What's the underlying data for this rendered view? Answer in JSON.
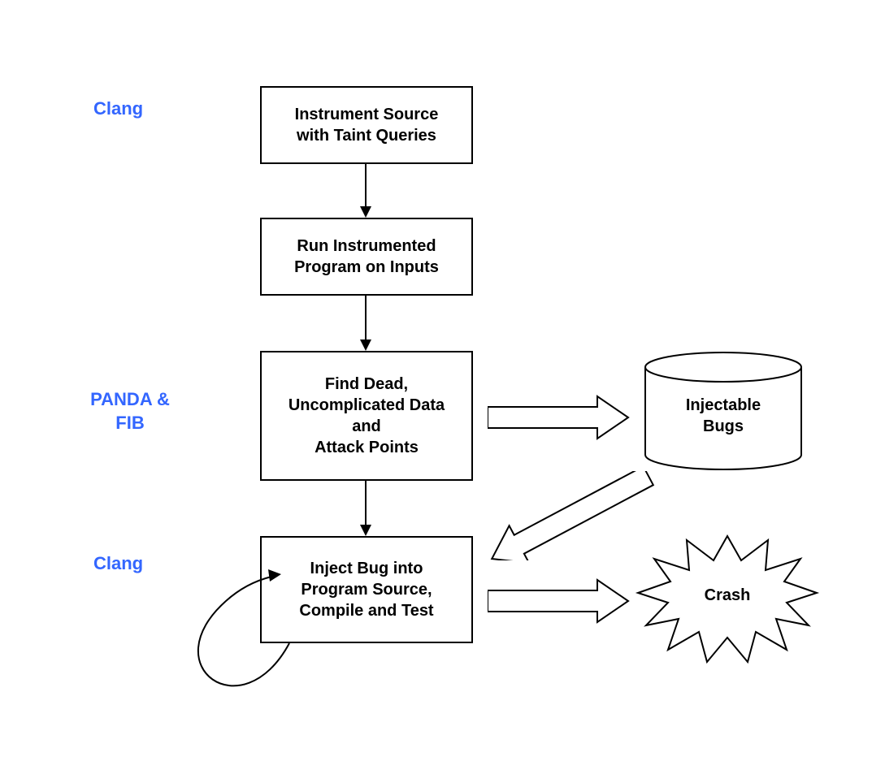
{
  "labels": {
    "l1": "Clang",
    "l2": "PANDA &\nFIB",
    "l3": "Clang"
  },
  "boxes": {
    "b1": "Instrument Source\nwith Taint Queries",
    "b2": "Run Instrumented\nProgram on Inputs",
    "b3": "Find Dead,\nUncomplicated Data\nand\nAttack Points",
    "b4": "Inject Bug into\nProgram Source,\nCompile and Test"
  },
  "datastore": "Injectable\nBugs",
  "result": "Crash"
}
